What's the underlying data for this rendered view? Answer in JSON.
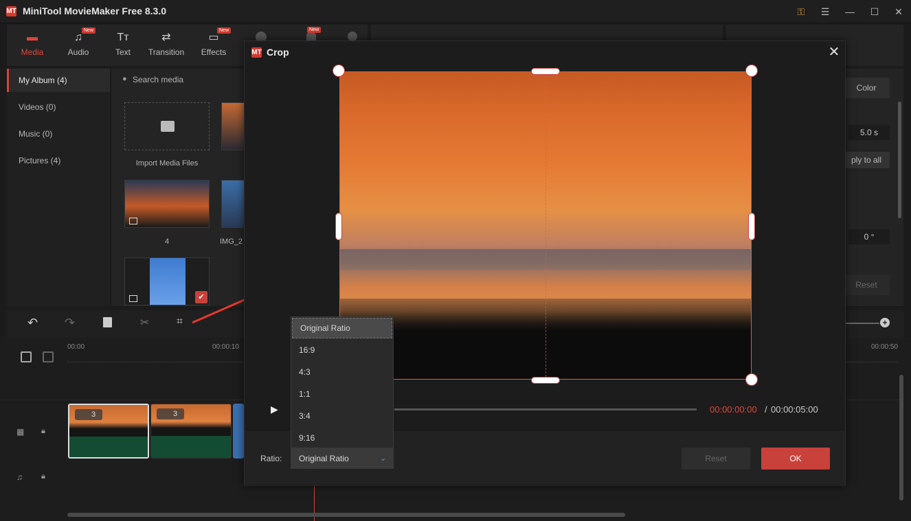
{
  "app": {
    "title": "MiniTool MovieMaker Free 8.3.0",
    "logo": "MT"
  },
  "toolbar": {
    "items": [
      {
        "label": "Media",
        "icon": "folder-icon",
        "active": true,
        "badge": ""
      },
      {
        "label": "Audio",
        "icon": "music-note-icon",
        "active": false,
        "badge": "New"
      },
      {
        "label": "Text",
        "icon": "text-icon",
        "active": false,
        "badge": ""
      },
      {
        "label": "Transition",
        "icon": "transition-icon",
        "active": false,
        "badge": ""
      },
      {
        "label": "Effects",
        "icon": "effects-icon",
        "active": false,
        "badge": "New"
      }
    ],
    "extra_badge": "New"
  },
  "leftnav": {
    "items": [
      {
        "label": "My Album (4)",
        "selected": true
      },
      {
        "label": "Videos (0)",
        "selected": false
      },
      {
        "label": "Music (0)",
        "selected": false
      },
      {
        "label": "Pictures (4)",
        "selected": false
      }
    ]
  },
  "media": {
    "search_placeholder": "Search media",
    "import_label": "Import Media Files",
    "items": [
      {
        "label": "4"
      },
      {
        "label": "IMG_2"
      }
    ]
  },
  "properties": {
    "color_label": "Color",
    "duration": "5.0 s",
    "apply_all": "ply to all",
    "rotation": "0 °",
    "reset": "Reset"
  },
  "timeline": {
    "ruler": [
      "00:00",
      "00:00:10",
      "00:00:50"
    ],
    "clips": [
      {
        "count": "3"
      },
      {
        "count": "3"
      }
    ]
  },
  "dialog": {
    "title": "Crop",
    "logo": "MT",
    "current_time": "00:00:00:00",
    "separator": "/",
    "total_time": "00:00:05:00",
    "ratio_label": "Ratio:",
    "ratio_value": "Original Ratio",
    "reset_label": "Reset",
    "ok_label": "OK",
    "ratio_options": [
      "Original Ratio",
      "16:9",
      "4:3",
      "1:1",
      "3:4",
      "9:16"
    ],
    "ratio_selected": "Original Ratio"
  },
  "colors": {
    "accent": "#d0453a",
    "ok_button": "#c8413a",
    "time_current": "#e0463a",
    "arrow": "#e8382d"
  }
}
